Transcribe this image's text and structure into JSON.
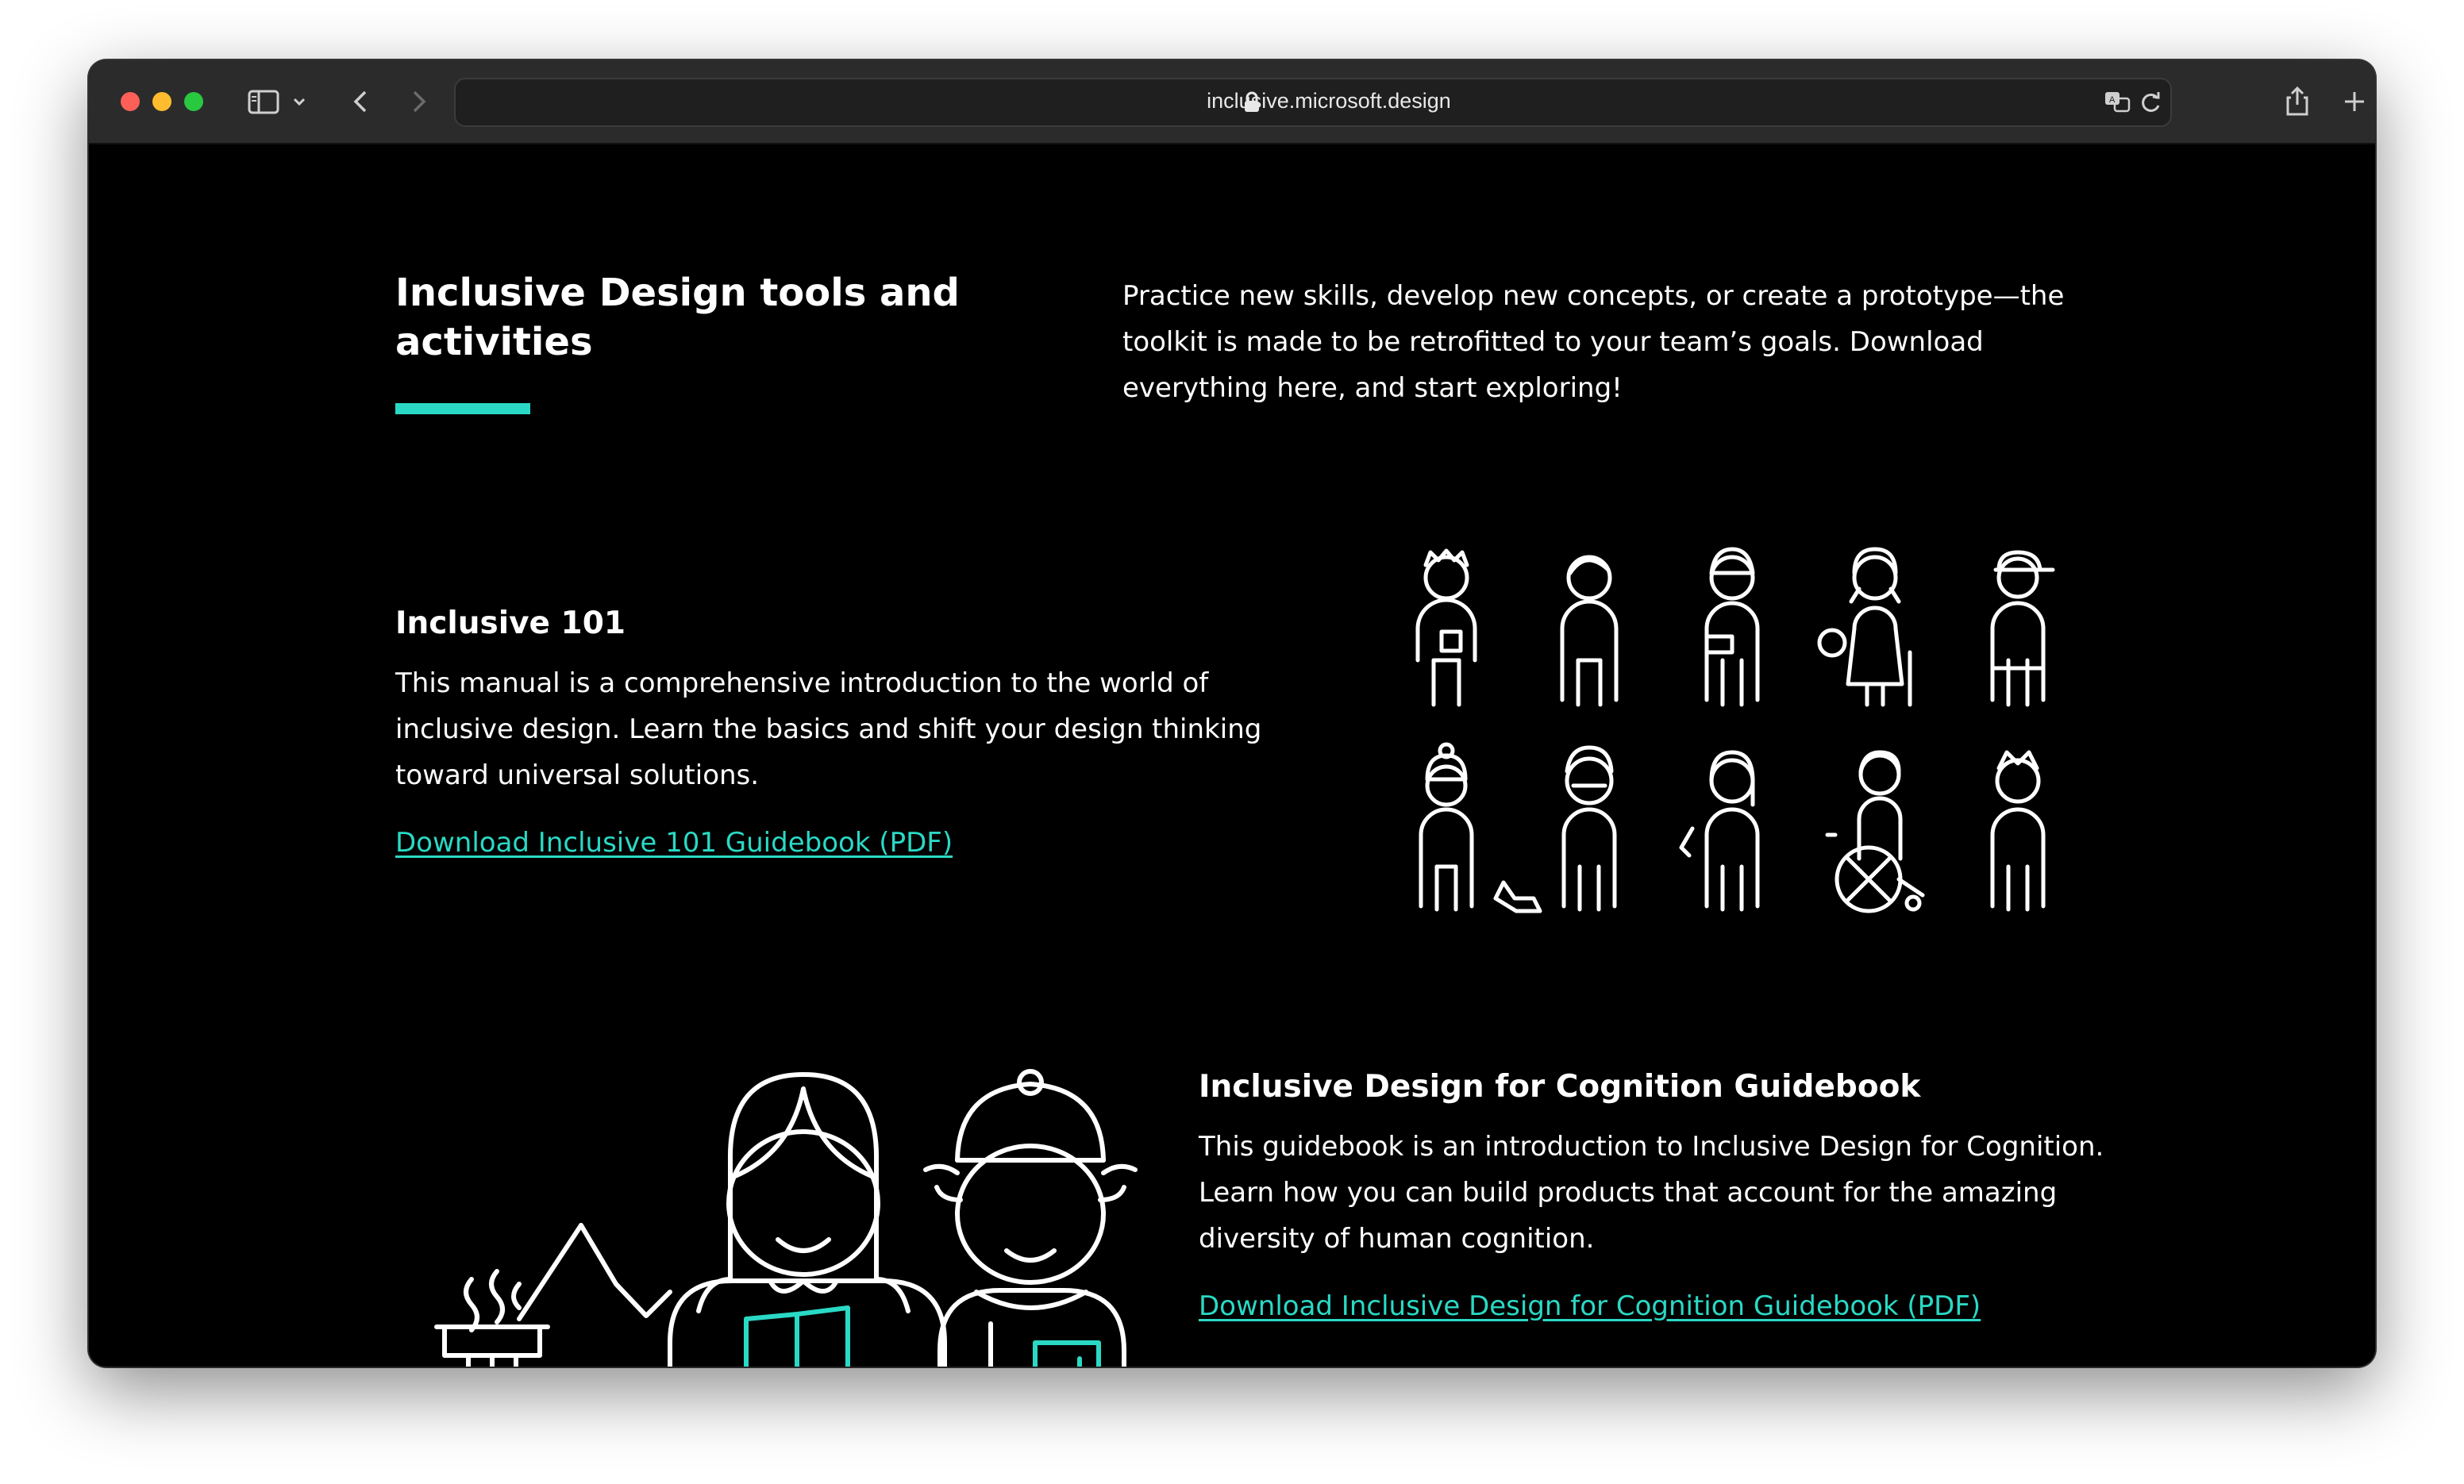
{
  "browser": {
    "url": "inclusive.microsoft.design",
    "traffic_lights": {
      "close": "#fe5f57",
      "minimize": "#febc2e",
      "zoom": "#28c840"
    },
    "icons": [
      "sidebar-icon",
      "chevron-down-icon",
      "back-icon",
      "forward-icon",
      "lock-icon",
      "translate-icon",
      "reload-icon",
      "share-icon",
      "new-tab-icon"
    ]
  },
  "header": {
    "title": "Inclusive Design tools and activities",
    "intro": "Practice new skills, develop new concepts, or create a prototype—the toolkit is made to be retrofitted to your team’s goals. Download everything here, and start exploring!"
  },
  "sections": [
    {
      "title": "Inclusive 101",
      "description": "This manual is a comprehensive introduction to the world of inclusive design. Learn the basics and shift your design thinking toward universal solutions.",
      "link": "Download Inclusive 101 Guidebook (PDF)"
    },
    {
      "title": "Inclusive Design for Cognition Guidebook",
      "description": "This guidebook is an introduction to Inclusive Design for Cognition. Learn how you can build products that account for the amazing diversity of human cognition.",
      "link": "Download Inclusive Design for Cognition Guidebook (PDF)"
    }
  ],
  "colors": {
    "accent": "#2ad9c5",
    "background": "#000000",
    "text": "#ffffff"
  }
}
